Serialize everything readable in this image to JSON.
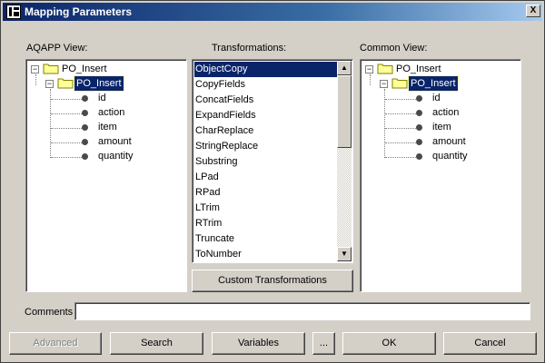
{
  "window": {
    "title": "Mapping Parameters",
    "close_label": "X"
  },
  "left_panel": {
    "label": "AQAPP View:",
    "tree": {
      "root": "PO_Insert",
      "child": "PO_Insert",
      "fields": [
        "id",
        "action",
        "item",
        "amount",
        "quantity"
      ]
    }
  },
  "middle_panel": {
    "label": "Transformations:",
    "items": [
      "ObjectCopy",
      "CopyFields",
      "ConcatFields",
      "ExpandFields",
      "CharReplace",
      "StringReplace",
      "Substring",
      "LPad",
      "RPad",
      "LTrim",
      "RTrim",
      "Truncate",
      "ToNumber"
    ],
    "selected": "ObjectCopy",
    "custom_button": "Custom Transformations"
  },
  "right_panel": {
    "label": "Common View:",
    "tree": {
      "root": "PO_Insert",
      "child": "PO_Insert",
      "fields": [
        "id",
        "action",
        "item",
        "amount",
        "quantity"
      ]
    }
  },
  "comments": {
    "label": "Comments",
    "value": ""
  },
  "buttons": {
    "advanced": "Advanced",
    "search": "Search",
    "variables": "Variables",
    "ellipsis": "...",
    "ok": "OK",
    "cancel": "Cancel"
  },
  "icons": {
    "tree_collapse": "minus-box-icon",
    "folder": "folder-icon",
    "field": "bullet-icon",
    "scroll_up": "arrow-up-icon",
    "scroll_down": "arrow-down-icon"
  },
  "colors": {
    "selection": "#0a246a",
    "title_start": "#0a246a",
    "title_end": "#a6caf0",
    "face": "#d4d0c8"
  }
}
